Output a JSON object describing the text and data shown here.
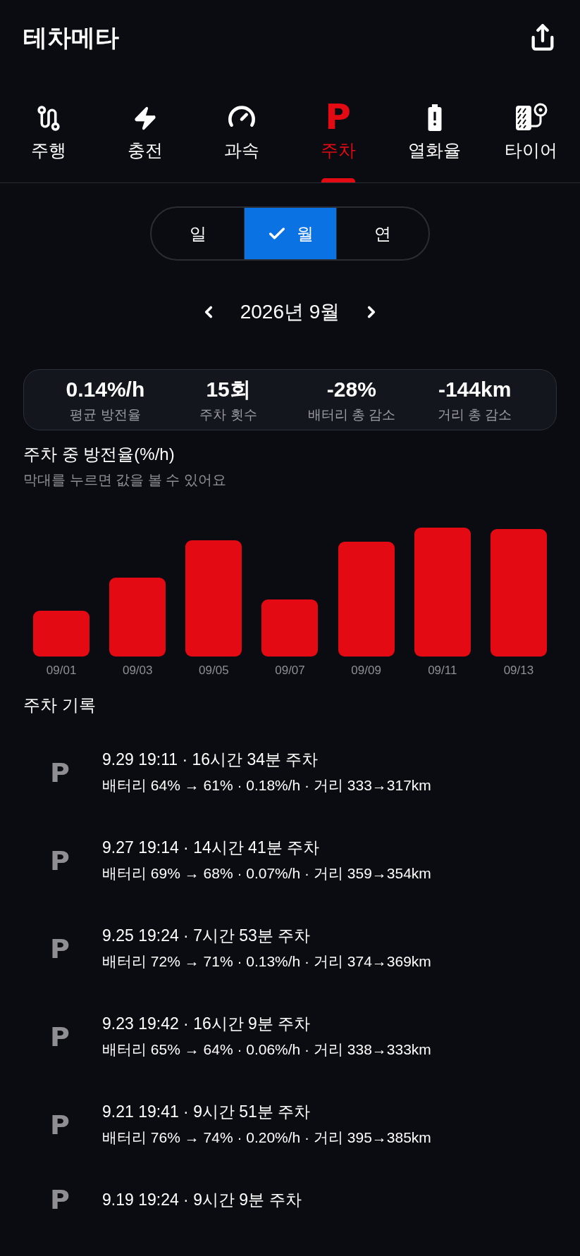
{
  "app_bar": {
    "title": "테차메타"
  },
  "tabs": [
    {
      "label": "주행",
      "selected": false
    },
    {
      "label": "충전",
      "selected": false
    },
    {
      "label": "과속",
      "selected": false
    },
    {
      "label": "주차",
      "selected": true,
      "glyph": "P"
    },
    {
      "label": "열화율",
      "selected": false
    },
    {
      "label": "타이어",
      "selected": false
    }
  ],
  "period_selector": [
    {
      "label": "일",
      "selected": false
    },
    {
      "label": "월",
      "selected": true
    },
    {
      "label": "연",
      "selected": false
    }
  ],
  "date_nav": {
    "label": "2026년 9월"
  },
  "summary": [
    {
      "value": "0.14%/h",
      "label": "평균 방전율"
    },
    {
      "value": "15회",
      "label": "주차 횟수"
    },
    {
      "value": "-28%",
      "label": "배터리 총 감소"
    },
    {
      "value": "-144km",
      "label": "거리 총 감소"
    }
  ],
  "chart": {
    "title": "주차 중 방전율(%/h)",
    "hint": "막대를 누르면 값을 볼 수 있어요",
    "x_labels": [
      "09/01",
      "09/03",
      "09/05",
      "09/07",
      "09/09",
      "09/11",
      "09/13"
    ]
  },
  "records": {
    "title": "주차 기록",
    "items": [
      {
        "glyph": "P",
        "title": "9.29 19:11 · 16시간 34분 주차",
        "detail": "배터리 64% → 61% · 0.18%/h · 거리 333→317km"
      },
      {
        "glyph": "P",
        "title": "9.27 19:14 · 14시간 41분 주차",
        "detail": "배터리 69% → 68% · 0.07%/h · 거리 359→354km"
      },
      {
        "glyph": "P",
        "title": "9.25 19:24 · 7시간 53분 주차",
        "detail": "배터리 72% → 71% · 0.13%/h · 거리 374→369km"
      },
      {
        "glyph": "P",
        "title": "9.23 19:42 · 16시간 9분 주차",
        "detail": "배터리 65% → 64% · 0.06%/h · 거리 338→333km"
      },
      {
        "glyph": "P",
        "title": "9.21 19:41 · 9시간 51분 주차",
        "detail": "배터리 76% → 74% · 0.20%/h · 거리 395→385km"
      },
      {
        "glyph": "P",
        "title": "9.19 19:24 · 9시간 9분 주차"
      }
    ]
  }
}
